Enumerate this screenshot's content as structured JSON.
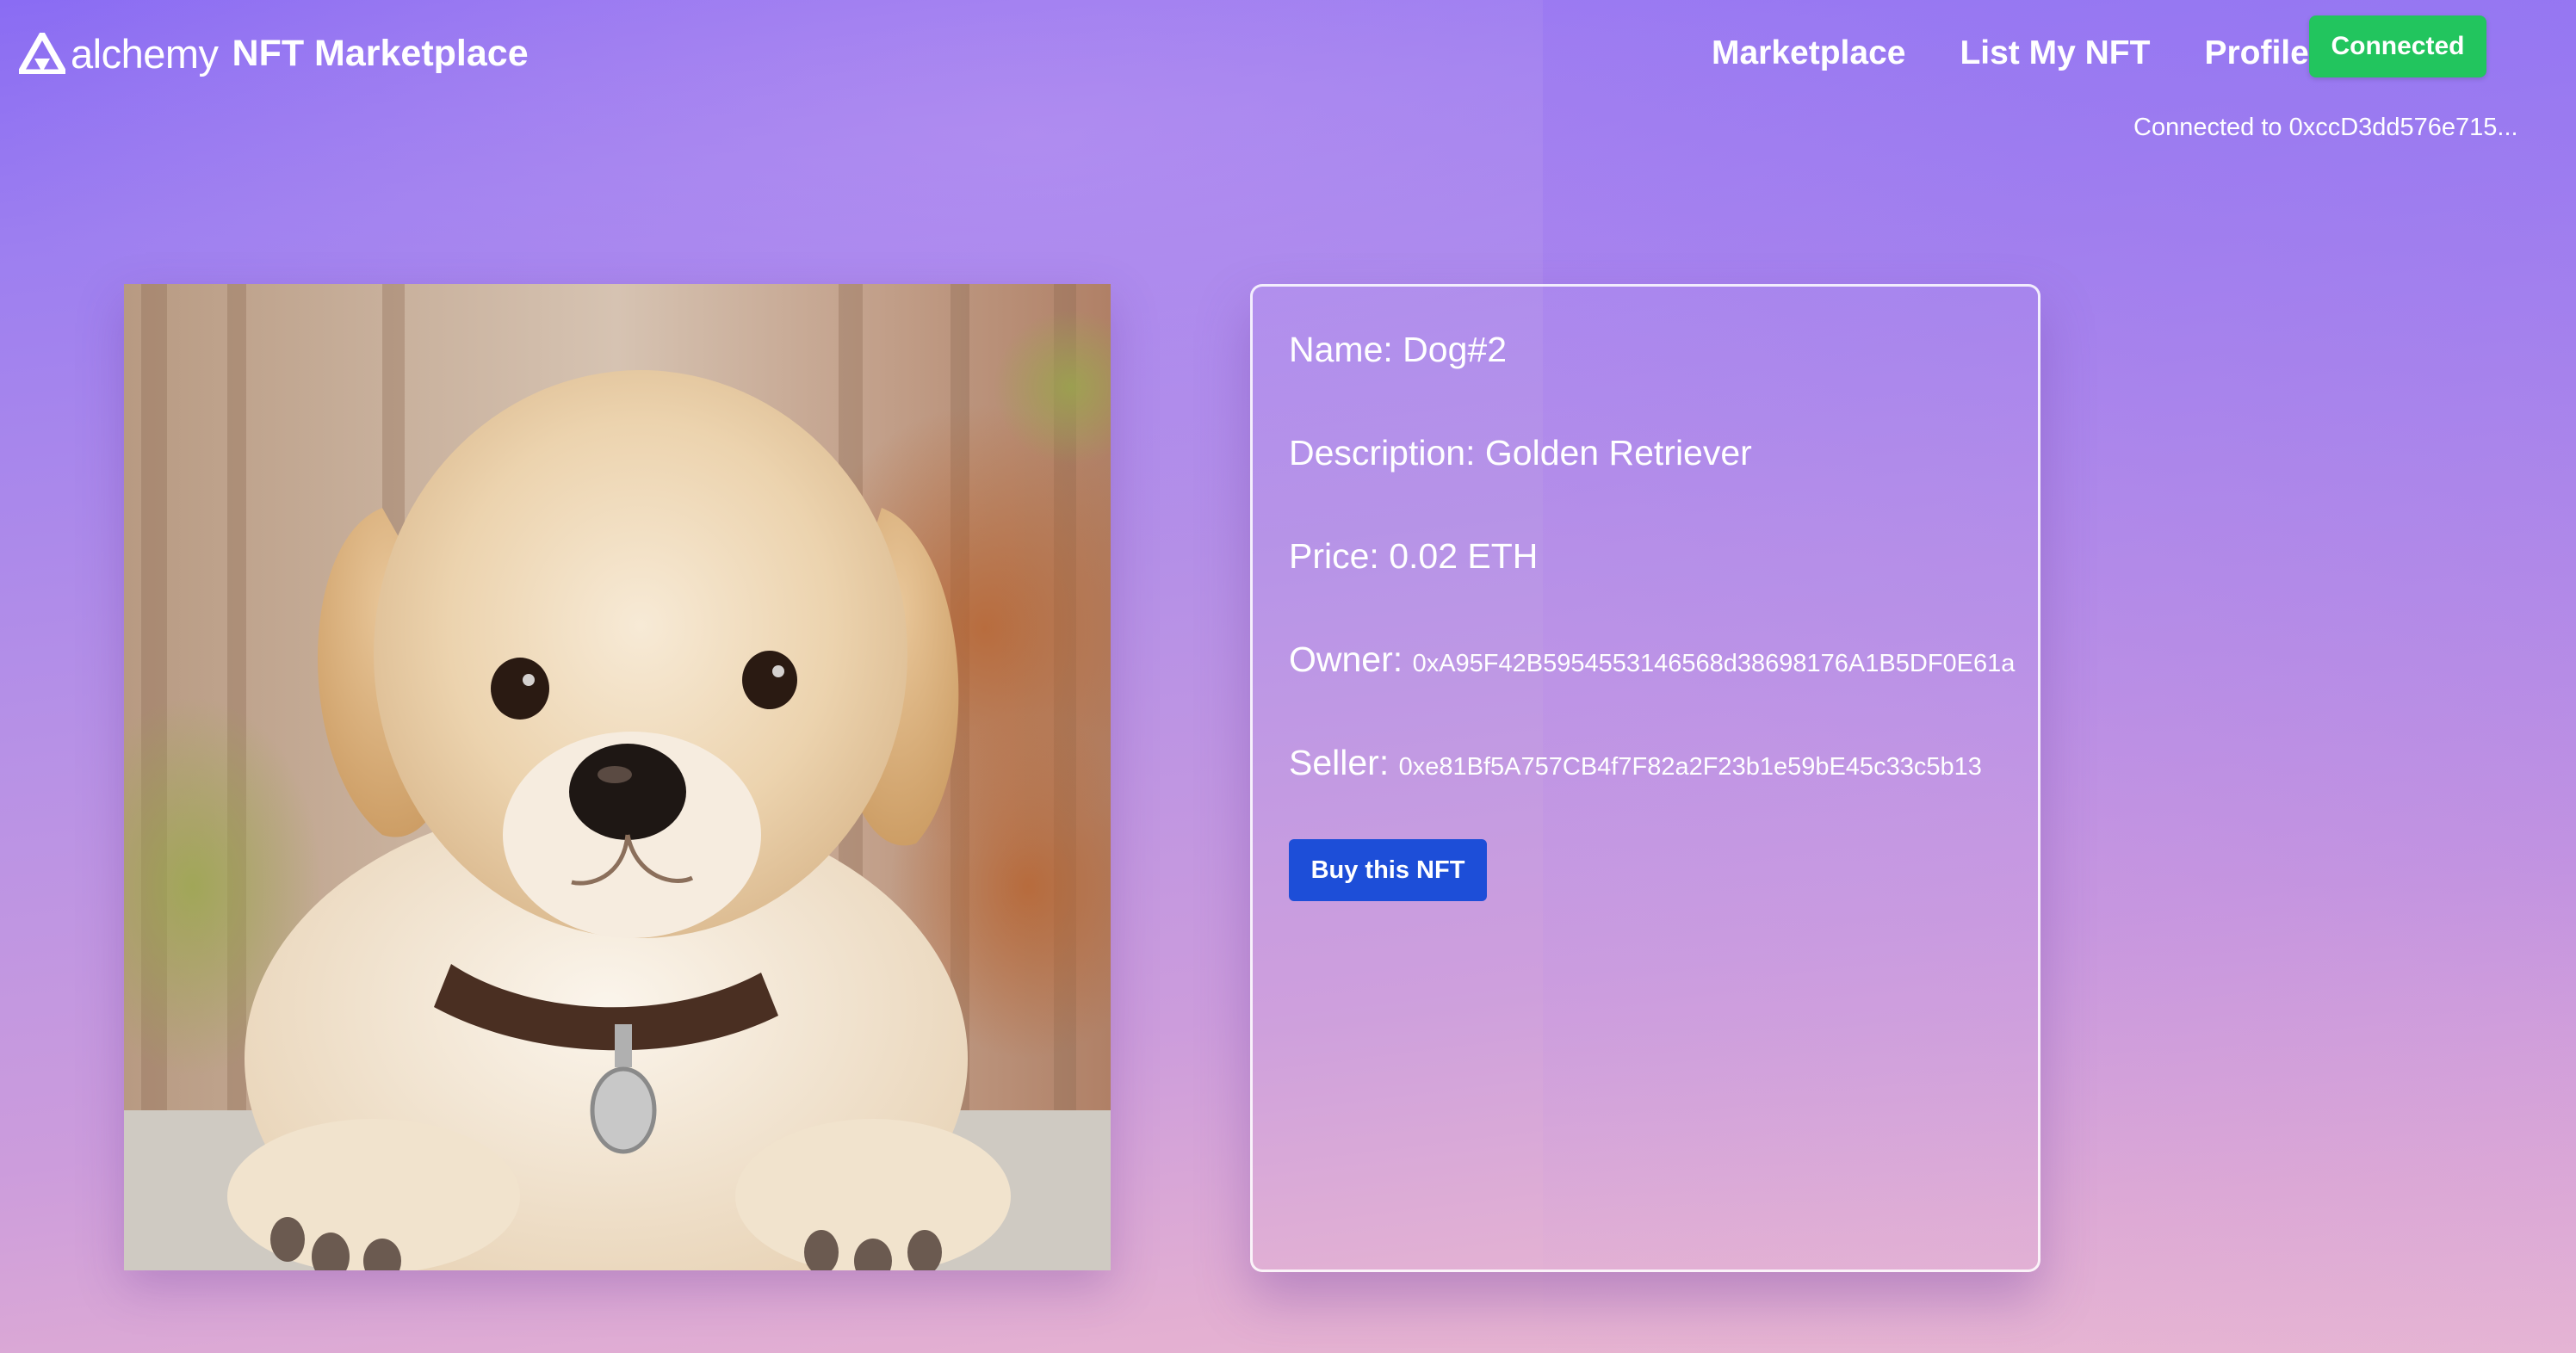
{
  "nav": {
    "logo_text": "alchemy",
    "site_title": "NFT Marketplace",
    "links": [
      "Marketplace",
      "List My NFT",
      "Profile"
    ],
    "connect_button": "Connected",
    "connected_to": "Connected to 0xccD3dd576e715..."
  },
  "nft": {
    "name_label": "Name:",
    "name": "Dog#2",
    "description_label": "Description:",
    "description": "Golden Retriever",
    "price_label": "Price:",
    "price": "0.02 ETH",
    "owner_label": "Owner:",
    "owner": "0xA95F42B5954553146568d38698176A1B5DF0E61a",
    "seller_label": "Seller:",
    "seller": "0xe81Bf5A757CB4f7F82a2F23b1e59bE45c33c5b13",
    "buy_button": "Buy this NFT"
  },
  "colors": {
    "connect_green": "#22c55e",
    "buy_blue": "#1d4ed8",
    "bg_top": "#8a6cf3",
    "bg_bottom": "#edbcd0"
  },
  "icons": {
    "logo": "alchemy-logo-icon",
    "image": "golden-retriever-puppy-image"
  }
}
